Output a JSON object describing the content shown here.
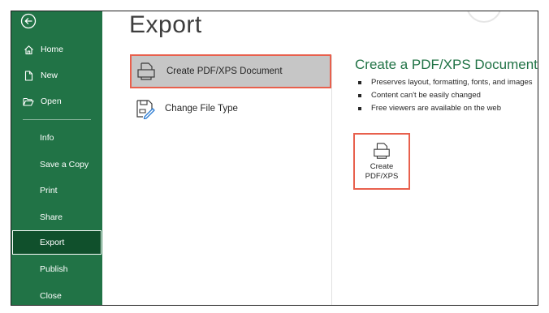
{
  "page": {
    "title": "Export"
  },
  "sidebar": {
    "items": [
      {
        "label": "Home",
        "icon": "home-icon"
      },
      {
        "label": "New",
        "icon": "new-document-icon"
      },
      {
        "label": "Open",
        "icon": "folder-open-icon"
      },
      {
        "label": "Info"
      },
      {
        "label": "Save a Copy"
      },
      {
        "label": "Print"
      },
      {
        "label": "Share"
      },
      {
        "label": "Export",
        "active": true
      },
      {
        "label": "Publish"
      },
      {
        "label": "Close"
      }
    ]
  },
  "export_options": [
    {
      "label": "Create PDF/XPS Document",
      "icon": "pdf-document-icon",
      "selected": true
    },
    {
      "label": "Change File Type",
      "icon": "change-file-type-icon",
      "selected": false
    }
  ],
  "detail": {
    "title": "Create a PDF/XPS Document",
    "bullets": [
      "Preserves layout, formatting, fonts, and images",
      "Content can't be easily changed",
      "Free viewers are available on the web"
    ],
    "button_line1": "Create",
    "button_line2": "PDF/XPS"
  },
  "colors": {
    "sidebar_bg": "#217346",
    "sidebar_active_bg": "#10502c",
    "highlight_border": "#e8604d",
    "selected_bg": "#c6c6c6",
    "accent_text": "#217346"
  }
}
